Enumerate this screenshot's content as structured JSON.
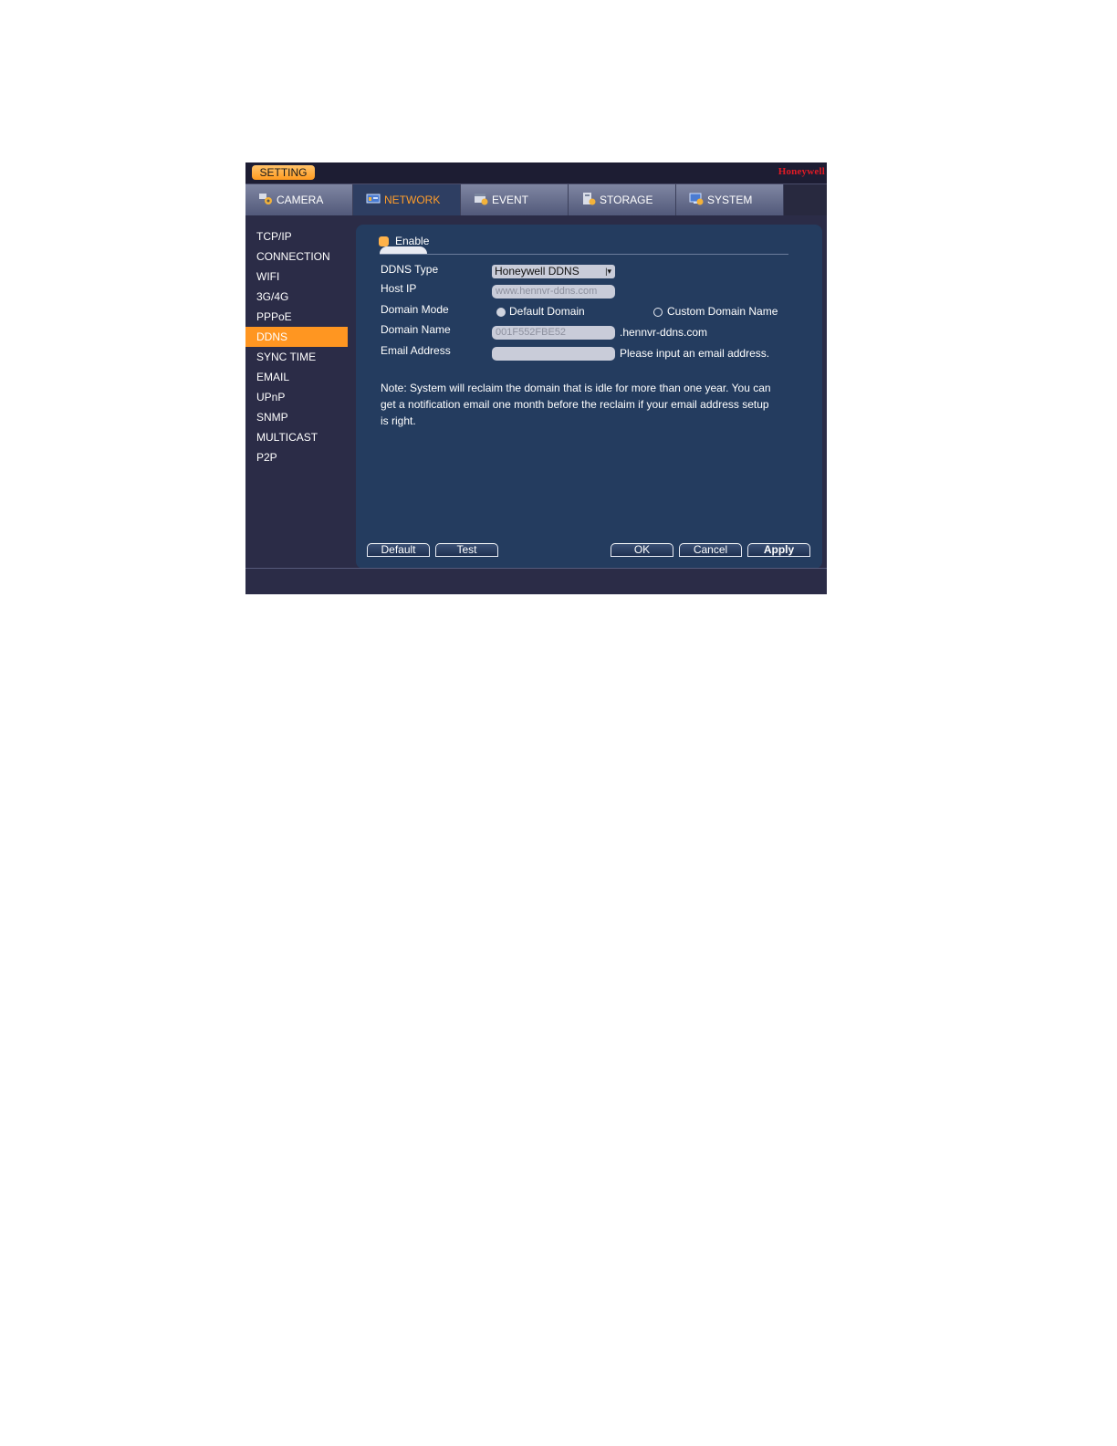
{
  "titlebar": {
    "setting_label": "SETTING",
    "brand": "Honeywell"
  },
  "tabs": [
    {
      "label": "CAMERA",
      "icon": "camera-settings-icon"
    },
    {
      "label": "NETWORK",
      "icon": "network-icon"
    },
    {
      "label": "EVENT",
      "icon": "event-icon"
    },
    {
      "label": "STORAGE",
      "icon": "storage-icon"
    },
    {
      "label": "SYSTEM",
      "icon": "system-icon"
    }
  ],
  "sidebar": {
    "items": [
      {
        "label": "TCP/IP"
      },
      {
        "label": "CONNECTION"
      },
      {
        "label": "WIFI"
      },
      {
        "label": "3G/4G"
      },
      {
        "label": "PPPoE"
      },
      {
        "label": "DDNS"
      },
      {
        "label": "SYNC TIME"
      },
      {
        "label": "EMAIL"
      },
      {
        "label": "UPnP"
      },
      {
        "label": "SNMP"
      },
      {
        "label": "MULTICAST"
      },
      {
        "label": "P2P"
      }
    ],
    "active": "DDNS"
  },
  "form": {
    "enable_label": "Enable",
    "ddns_type_label": "DDNS Type",
    "ddns_type_value": "Honeywell DDNS",
    "host_ip_label": "Host IP",
    "host_ip_value": "www.hennvr-ddns.com",
    "domain_mode_label": "Domain Mode",
    "default_domain_label": "Default Domain",
    "custom_domain_label": "Custom Domain Name",
    "domain_name_label": "Domain Name",
    "domain_name_value": "001F552FBE52",
    "domain_suffix": ".hennvr-ddns.com",
    "email_label": "Email Address",
    "email_value": "",
    "email_hint": "Please input an email address.",
    "note_line1": "Note: System will reclaim the domain that is idle for more than one year. You can",
    "note_line2": "get a notification email one month before the reclaim if your email address setup",
    "note_line3": "is right."
  },
  "buttons": {
    "default": "Default",
    "test": "Test",
    "ok": "OK",
    "cancel": "Cancel",
    "apply": "Apply"
  },
  "colors": {
    "accent": "#ff9621",
    "panel": "#243c5f",
    "brand": "#e21b25"
  }
}
